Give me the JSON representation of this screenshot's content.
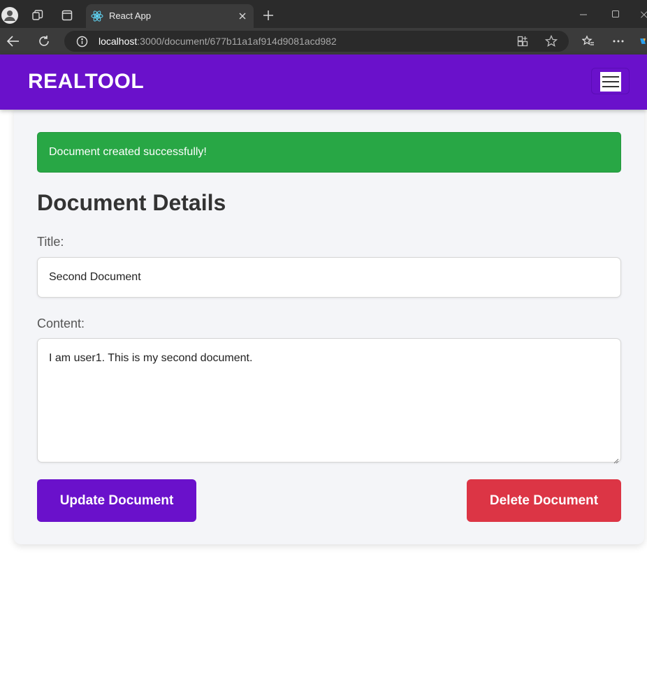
{
  "browser": {
    "tab_title": "React App",
    "url_host": "localhost",
    "url_rest": ":3000/document/677b11a1af914d9081acd982"
  },
  "navbar": {
    "brand": "REALTOOL",
    "brand_color": "#6a11cb"
  },
  "alert": {
    "message": "Document created successfully!",
    "color": "#28a745"
  },
  "document": {
    "heading": "Document Details",
    "title_label": "Title:",
    "title_value": "Second Document",
    "content_label": "Content:",
    "content_value": "I am user1. This is my second document."
  },
  "actions": {
    "update_label": "Update Document",
    "delete_label": "Delete Document",
    "delete_color": "#dc3545"
  }
}
